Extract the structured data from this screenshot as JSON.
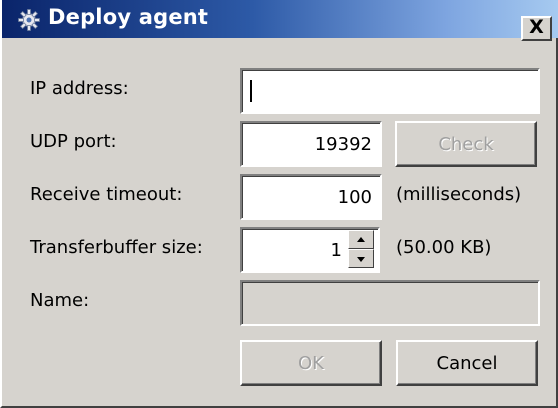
{
  "window": {
    "title": "Deploy agent",
    "close_label": "X"
  },
  "fields": {
    "ip_label": "IP address:",
    "ip_value": "",
    "udp_label": "UDP port:",
    "udp_value": "19392",
    "check_label": "Check",
    "timeout_label": "Receive timeout:",
    "timeout_value": "100",
    "timeout_unit": "(milliseconds)",
    "buffer_label": "Transferbuffer size:",
    "buffer_value": "1",
    "buffer_size_text": "(50.00 KB)",
    "name_label": "Name:",
    "name_value": ""
  },
  "buttons": {
    "ok_label": "OK",
    "cancel_label": "Cancel"
  },
  "icons": {
    "title_icon": "gear-icon",
    "spin_up": "triangle-up-icon",
    "spin_down": "triangle-down-icon"
  },
  "colors": {
    "title_gradient_start": "#0a246a",
    "title_gradient_end": "#a6caf0",
    "dialog_bg": "#d6d3ce",
    "disabled_text": "#a0a0a0"
  }
}
